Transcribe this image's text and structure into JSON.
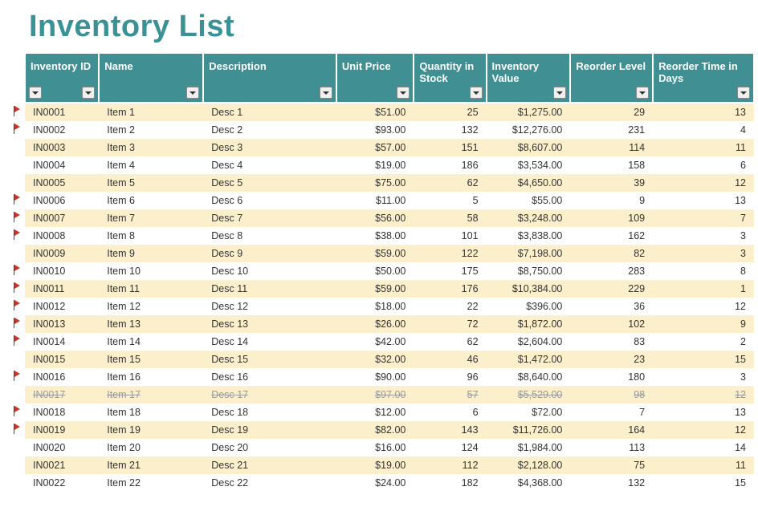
{
  "title": "Inventory List",
  "columns": [
    {
      "key": "id",
      "label": "Inventory ID",
      "align": "left"
    },
    {
      "key": "name",
      "label": "Name",
      "align": "left"
    },
    {
      "key": "desc",
      "label": "Description",
      "align": "left"
    },
    {
      "key": "price",
      "label": "Unit Price",
      "align": "right"
    },
    {
      "key": "qty",
      "label": "Quantity in Stock",
      "align": "right"
    },
    {
      "key": "value",
      "label": "Inventory Value",
      "align": "right"
    },
    {
      "key": "reorder",
      "label": "Reorder Level",
      "align": "right"
    },
    {
      "key": "days",
      "label": "Reorder Time in Days",
      "align": "right"
    }
  ],
  "rows": [
    {
      "flag": true,
      "shaded": true,
      "id": "IN0001",
      "name": "Item 1",
      "desc": "Desc 1",
      "price": "$51.00",
      "qty": "25",
      "value": "$1,275.00",
      "reorder": "29",
      "days": "13"
    },
    {
      "flag": true,
      "shaded": false,
      "id": "IN0002",
      "name": "Item 2",
      "desc": "Desc 2",
      "price": "$93.00",
      "qty": "132",
      "value": "$12,276.00",
      "reorder": "231",
      "days": "4"
    },
    {
      "flag": false,
      "shaded": true,
      "id": "IN0003",
      "name": "Item 3",
      "desc": "Desc 3",
      "price": "$57.00",
      "qty": "151",
      "value": "$8,607.00",
      "reorder": "114",
      "days": "11"
    },
    {
      "flag": false,
      "shaded": false,
      "id": "IN0004",
      "name": "Item 4",
      "desc": "Desc 4",
      "price": "$19.00",
      "qty": "186",
      "value": "$3,534.00",
      "reorder": "158",
      "days": "6"
    },
    {
      "flag": false,
      "shaded": true,
      "id": "IN0005",
      "name": "Item 5",
      "desc": "Desc 5",
      "price": "$75.00",
      "qty": "62",
      "value": "$4,650.00",
      "reorder": "39",
      "days": "12"
    },
    {
      "flag": true,
      "shaded": false,
      "id": "IN0006",
      "name": "Item 6",
      "desc": "Desc 6",
      "price": "$11.00",
      "qty": "5",
      "value": "$55.00",
      "reorder": "9",
      "days": "13"
    },
    {
      "flag": true,
      "shaded": true,
      "id": "IN0007",
      "name": "Item 7",
      "desc": "Desc 7",
      "price": "$56.00",
      "qty": "58",
      "value": "$3,248.00",
      "reorder": "109",
      "days": "7"
    },
    {
      "flag": true,
      "shaded": false,
      "id": "IN0008",
      "name": "Item 8",
      "desc": "Desc 8",
      "price": "$38.00",
      "qty": "101",
      "value": "$3,838.00",
      "reorder": "162",
      "days": "3"
    },
    {
      "flag": false,
      "shaded": true,
      "id": "IN0009",
      "name": "Item 9",
      "desc": "Desc 9",
      "price": "$59.00",
      "qty": "122",
      "value": "$7,198.00",
      "reorder": "82",
      "days": "3"
    },
    {
      "flag": true,
      "shaded": false,
      "id": "IN0010",
      "name": "Item 10",
      "desc": "Desc 10",
      "price": "$50.00",
      "qty": "175",
      "value": "$8,750.00",
      "reorder": "283",
      "days": "8"
    },
    {
      "flag": true,
      "shaded": true,
      "id": "IN0011",
      "name": "Item 11",
      "desc": "Desc 11",
      "price": "$59.00",
      "qty": "176",
      "value": "$10,384.00",
      "reorder": "229",
      "days": "1"
    },
    {
      "flag": true,
      "shaded": false,
      "id": "IN0012",
      "name": "Item 12",
      "desc": "Desc 12",
      "price": "$18.00",
      "qty": "22",
      "value": "$396.00",
      "reorder": "36",
      "days": "12"
    },
    {
      "flag": true,
      "shaded": true,
      "id": "IN0013",
      "name": "Item 13",
      "desc": "Desc 13",
      "price": "$26.00",
      "qty": "72",
      "value": "$1,872.00",
      "reorder": "102",
      "days": "9"
    },
    {
      "flag": true,
      "shaded": false,
      "id": "IN0014",
      "name": "Item 14",
      "desc": "Desc 14",
      "price": "$42.00",
      "qty": "62",
      "value": "$2,604.00",
      "reorder": "83",
      "days": "2"
    },
    {
      "flag": false,
      "shaded": true,
      "id": "IN0015",
      "name": "Item 15",
      "desc": "Desc 15",
      "price": "$32.00",
      "qty": "46",
      "value": "$1,472.00",
      "reorder": "23",
      "days": "15"
    },
    {
      "flag": true,
      "shaded": false,
      "id": "IN0016",
      "name": "Item 16",
      "desc": "Desc 16",
      "price": "$90.00",
      "qty": "96",
      "value": "$8,640.00",
      "reorder": "180",
      "days": "3"
    },
    {
      "flag": false,
      "shaded": true,
      "disc": true,
      "id": "IN0017",
      "name": "Item 17",
      "desc": "Desc 17",
      "price": "$97.00",
      "qty": "57",
      "value": "$5,529.00",
      "reorder": "98",
      "days": "12"
    },
    {
      "flag": true,
      "shaded": false,
      "id": "IN0018",
      "name": "Item 18",
      "desc": "Desc 18",
      "price": "$12.00",
      "qty": "6",
      "value": "$72.00",
      "reorder": "7",
      "days": "13"
    },
    {
      "flag": true,
      "shaded": true,
      "id": "IN0019",
      "name": "Item 19",
      "desc": "Desc 19",
      "price": "$82.00",
      "qty": "143",
      "value": "$11,726.00",
      "reorder": "164",
      "days": "12"
    },
    {
      "flag": false,
      "shaded": false,
      "id": "IN0020",
      "name": "Item 20",
      "desc": "Desc 20",
      "price": "$16.00",
      "qty": "124",
      "value": "$1,984.00",
      "reorder": "113",
      "days": "14"
    },
    {
      "flag": false,
      "shaded": true,
      "id": "IN0021",
      "name": "Item 21",
      "desc": "Desc 21",
      "price": "$19.00",
      "qty": "112",
      "value": "$2,128.00",
      "reorder": "75",
      "days": "11"
    },
    {
      "flag": false,
      "shaded": false,
      "id": "IN0022",
      "name": "Item 22",
      "desc": "Desc 22",
      "price": "$24.00",
      "qty": "182",
      "value": "$4,368.00",
      "reorder": "132",
      "days": "15"
    }
  ]
}
